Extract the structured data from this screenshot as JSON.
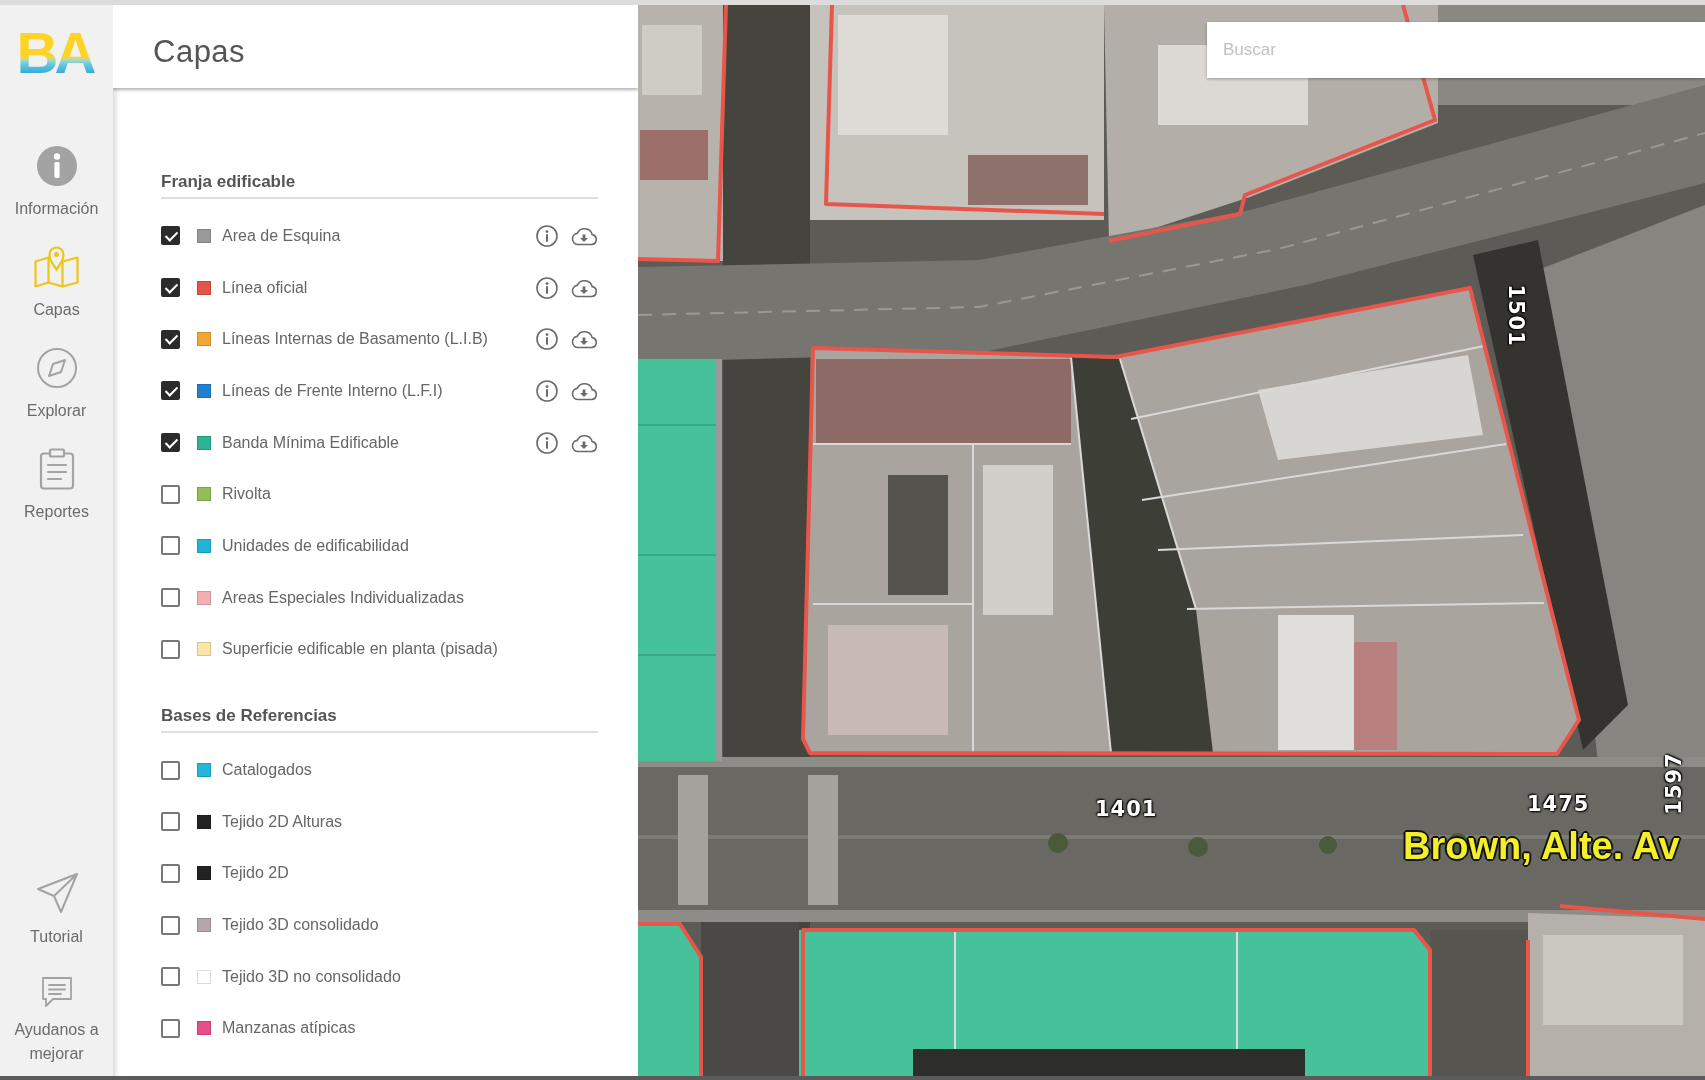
{
  "sidebar": {
    "logo": "BA",
    "items": [
      {
        "kind": "info",
        "label": "Información",
        "selected": false
      },
      {
        "kind": "layers",
        "label": "Capas",
        "selected": true
      },
      {
        "kind": "explore",
        "label": "Explorar",
        "selected": false
      },
      {
        "kind": "reports",
        "label": "Reportes",
        "selected": false
      }
    ],
    "bottom_items": [
      {
        "kind": "tutorial",
        "label": "Tutorial",
        "selected": false
      },
      {
        "kind": "feedback",
        "label": "Ayudanos a mejorar",
        "selected": false
      }
    ]
  },
  "panel": {
    "title": "Capas",
    "sections": [
      {
        "title": "Franja edificable",
        "layers": [
          {
            "name": "Area de Esquina",
            "color": "#9a9a9a",
            "checked": true
          },
          {
            "name": "Línea oficial",
            "color": "#e5534b",
            "checked": true
          },
          {
            "name": "Líneas Internas de Basamento (L.I.B)",
            "color": "#f4a534",
            "checked": true
          },
          {
            "name": "Líneas de Frente Interno (L.F.I)",
            "color": "#1f80d0",
            "checked": true
          },
          {
            "name": "Banda Mínima Edificable",
            "color": "#2db395",
            "checked": true
          },
          {
            "name": "Rivolta",
            "color": "#8fbf55",
            "checked": false
          },
          {
            "name": "Unidades de edificabilidad",
            "color": "#22b4d6",
            "checked": false
          },
          {
            "name": "Areas Especiales Individualizadas",
            "color": "#f2b0b0",
            "checked": false
          },
          {
            "name": "Superficie edificable en planta (pisada)",
            "color": "#fbe6a6",
            "checked": false
          }
        ]
      },
      {
        "title": "Bases de Referencias",
        "layers": [
          {
            "name": "Catalogados",
            "color": "#22b6d8",
            "checked": false
          },
          {
            "name": "Tejido 2D Alturas",
            "color": "#222222",
            "checked": false
          },
          {
            "name": "Tejido 2D",
            "color": "#222222",
            "checked": false
          },
          {
            "name": "Tejido 3D consolidado",
            "color": "#b4a6aa",
            "checked": false
          },
          {
            "name": "Tejido 3D no consolidado",
            "color": "#ffffff",
            "checked": false
          },
          {
            "name": "Manzanas atípicas",
            "color": "#e64f8c",
            "checked": false
          }
        ]
      }
    ]
  },
  "search": {
    "placeholder": "Buscar"
  },
  "map": {
    "labels": [
      {
        "kind": "house_number",
        "text": "1501"
      },
      {
        "kind": "house_number",
        "text": "1597"
      },
      {
        "kind": "house_number",
        "text": "1401"
      },
      {
        "kind": "house_number",
        "text": "1475"
      },
      {
        "kind": "street_name",
        "text": "Brown, Alte. Av"
      }
    ]
  }
}
